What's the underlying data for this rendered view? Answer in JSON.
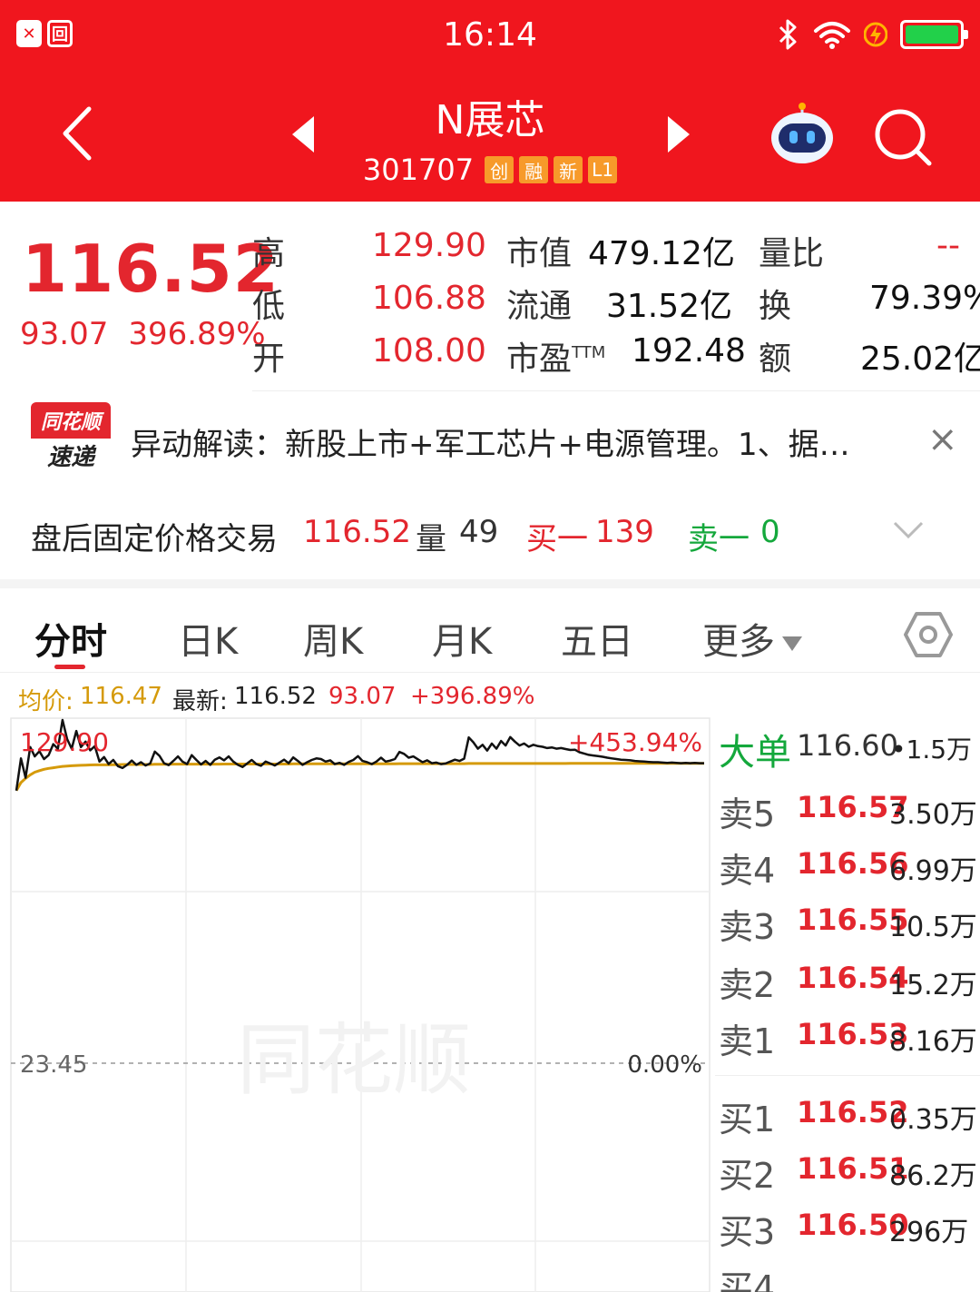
{
  "status_bar": {
    "time": "16:14",
    "left_icon_1": "✕",
    "left_icon_2": "回"
  },
  "header": {
    "stock_name": "N展芯",
    "stock_code": "301707",
    "tags": [
      "创",
      "融",
      "新",
      "L1"
    ],
    "icons": [
      "back-arrow-icon",
      "prev-arrow-icon",
      "next-arrow-icon",
      "robot-icon",
      "search-icon"
    ]
  },
  "quote": {
    "price": "116.52",
    "change": "93.07",
    "change_pct": "396.89%",
    "high_label": "高",
    "high": "129.90",
    "low_label": "低",
    "low": "106.88",
    "open_label": "开",
    "open": "108.00",
    "mktcap_label": "市值",
    "mktcap": "479.12亿",
    "float_label": "流通",
    "float": "31.52亿",
    "pe_label": "市盈",
    "pe_sup": "TTM",
    "pe": "192.48",
    "volratio_label": "量比",
    "volratio": "--",
    "turnover_label": "换",
    "turnover": "79.39%",
    "amount_label": "额",
    "amount": "25.02亿"
  },
  "news": {
    "logo_top": "同花顺",
    "logo_bottom": "速递",
    "text": "异动解读：新股上市+军工芯片+电源管理。1、据…",
    "close": "×"
  },
  "after_hours": {
    "label": "盘后固定价格交易",
    "price": "116.52",
    "vol_label": "量",
    "vol": "49",
    "bid_label": "买一",
    "bid": "139",
    "ask_label": "卖一",
    "ask": "0"
  },
  "tabs": [
    "分时",
    "日K",
    "周K",
    "月K",
    "五日",
    "更多"
  ],
  "chart_header": {
    "avg_label": "均价:",
    "avg": "116.47",
    "latest_label": "最新:",
    "latest": "116.52",
    "change": "93.07",
    "change_pct": "+396.89%"
  },
  "chart_data": {
    "type": "line",
    "title": "",
    "y_top_label": "129.90",
    "y_top_pct": "+453.94%",
    "y_ref_label": "23.45",
    "y_ref_pct": "0.00%",
    "ylim": [
      23.45,
      129.9
    ],
    "series": [
      {
        "name": "最新",
        "color": "#111111",
        "values": [
          108.0,
          118.0,
          112.0,
          121.5,
          118.6,
          120.2,
          117.8,
          119.0,
          122.4,
          121.0,
          129.9,
          124.0,
          121.0,
          126.5,
          121.5,
          123.2,
          120.5,
          121.8,
          117.0,
          118.4,
          116.2,
          117.5,
          115.6,
          115.0,
          116.0,
          117.3,
          116.0,
          116.8,
          115.8,
          116.4,
          120.1,
          118.8,
          116.5,
          115.9,
          117.2,
          118.6,
          117.0,
          116.2,
          119.0,
          117.5,
          116.1,
          117.2,
          116.0,
          117.6,
          118.3,
          117.4,
          118.6,
          117.0,
          116.0,
          115.3,
          116.4,
          117.5,
          116.2,
          115.7,
          117.0,
          116.4,
          115.8,
          116.7,
          117.6,
          116.5,
          118.3,
          117.2,
          116.0,
          116.8,
          117.5,
          118.0,
          117.8,
          117.0,
          117.4,
          116.2,
          116.6,
          116.0,
          116.9,
          117.5,
          118.7,
          117.2,
          116.8,
          116.2,
          117.0,
          118.2,
          117.0,
          117.3,
          117.8,
          120.0,
          119.4,
          118.2,
          118.6,
          117.7,
          116.8,
          117.4,
          116.5,
          116.7,
          116.2,
          116.4,
          117.0,
          117.6,
          117.2,
          117.9,
          124.5,
          123.0,
          121.0,
          122.2,
          120.4,
          122.6,
          121.0,
          123.4,
          122.0,
          124.6,
          123.2,
          122.0,
          122.6,
          121.6,
          122.2,
          121.8,
          121.6,
          121.2,
          121.4,
          121.0,
          121.2,
          120.9,
          120.6,
          120.7,
          119.9,
          119.5,
          119.1,
          118.9,
          118.7,
          118.5,
          118.2,
          118.0,
          117.8,
          117.6,
          117.5,
          117.4,
          117.2,
          117.1,
          117.0,
          116.9,
          116.8,
          116.8,
          116.7,
          116.6,
          116.7,
          116.6,
          116.5,
          116.6,
          116.5,
          116.6,
          116.5,
          116.5
        ]
      },
      {
        "name": "均价",
        "color": "#d59a0a",
        "values": [
          108.0,
          110.5,
          111.8,
          112.9,
          113.7,
          114.2,
          114.6,
          114.9,
          115.1,
          115.3,
          115.5,
          115.6,
          115.7,
          115.8,
          115.85,
          115.9,
          115.95,
          116.0,
          116.0,
          116.0,
          116.0,
          116.05,
          116.05,
          116.1,
          116.1,
          116.1,
          116.1,
          116.1,
          116.1,
          116.1,
          116.15,
          116.15,
          116.15,
          116.15,
          116.2,
          116.2,
          116.2,
          116.2,
          116.2,
          116.2,
          116.2,
          116.2,
          116.2,
          116.2,
          116.2,
          116.25,
          116.25,
          116.25,
          116.25,
          116.25,
          116.25,
          116.25,
          116.25,
          116.25,
          116.25,
          116.25,
          116.25,
          116.25,
          116.25,
          116.25,
          116.3,
          116.3,
          116.3,
          116.3,
          116.3,
          116.3,
          116.3,
          116.3,
          116.3,
          116.3,
          116.3,
          116.3,
          116.3,
          116.3,
          116.3,
          116.3,
          116.3,
          116.3,
          116.3,
          116.3,
          116.3,
          116.3,
          116.3,
          116.35,
          116.35,
          116.35,
          116.35,
          116.35,
          116.35,
          116.35,
          116.35,
          116.35,
          116.35,
          116.35,
          116.35,
          116.35,
          116.35,
          116.35,
          116.4,
          116.4,
          116.4,
          116.4,
          116.4,
          116.4,
          116.4,
          116.4,
          116.4,
          116.4,
          116.4,
          116.4,
          116.4,
          116.4,
          116.4,
          116.4,
          116.4,
          116.4,
          116.4,
          116.4,
          116.4,
          116.4,
          116.45,
          116.45,
          116.45,
          116.45,
          116.45,
          116.45,
          116.45,
          116.45,
          116.45,
          116.45,
          116.45,
          116.45,
          116.45,
          116.45,
          116.45,
          116.45,
          116.45,
          116.45,
          116.45,
          116.45,
          116.47,
          116.47,
          116.47,
          116.47,
          116.47,
          116.47,
          116.47,
          116.47,
          116.47,
          116.47
        ]
      }
    ],
    "grid": true,
    "watermark": "同花顺"
  },
  "order_book": {
    "big_label": "大单",
    "big_price": "116.60",
    "big_vol": "•1.5万",
    "asks": [
      {
        "label": "卖5",
        "price": "116.57",
        "vol": "3.50万"
      },
      {
        "label": "卖4",
        "price": "116.56",
        "vol": "6.99万"
      },
      {
        "label": "卖3",
        "price": "116.55",
        "vol": "10.5万"
      },
      {
        "label": "卖2",
        "price": "116.54",
        "vol": "15.2万"
      },
      {
        "label": "卖1",
        "price": "116.53",
        "vol": "8.16万"
      }
    ],
    "bids": [
      {
        "label": "买1",
        "price": "116.52",
        "vol": "0.35万"
      },
      {
        "label": "买2",
        "price": "116.51",
        "vol": "86.2万"
      },
      {
        "label": "买3",
        "price": "116.50",
        "vol": "296万"
      },
      {
        "label": "买4",
        "price": "",
        "vol": ""
      }
    ]
  },
  "colors": {
    "header_red": "#f0161e",
    "up_red": "#e3262e",
    "down_green": "#14a83c",
    "avg_gold": "#d59a0a",
    "tag_orange": "#f79a2a"
  }
}
